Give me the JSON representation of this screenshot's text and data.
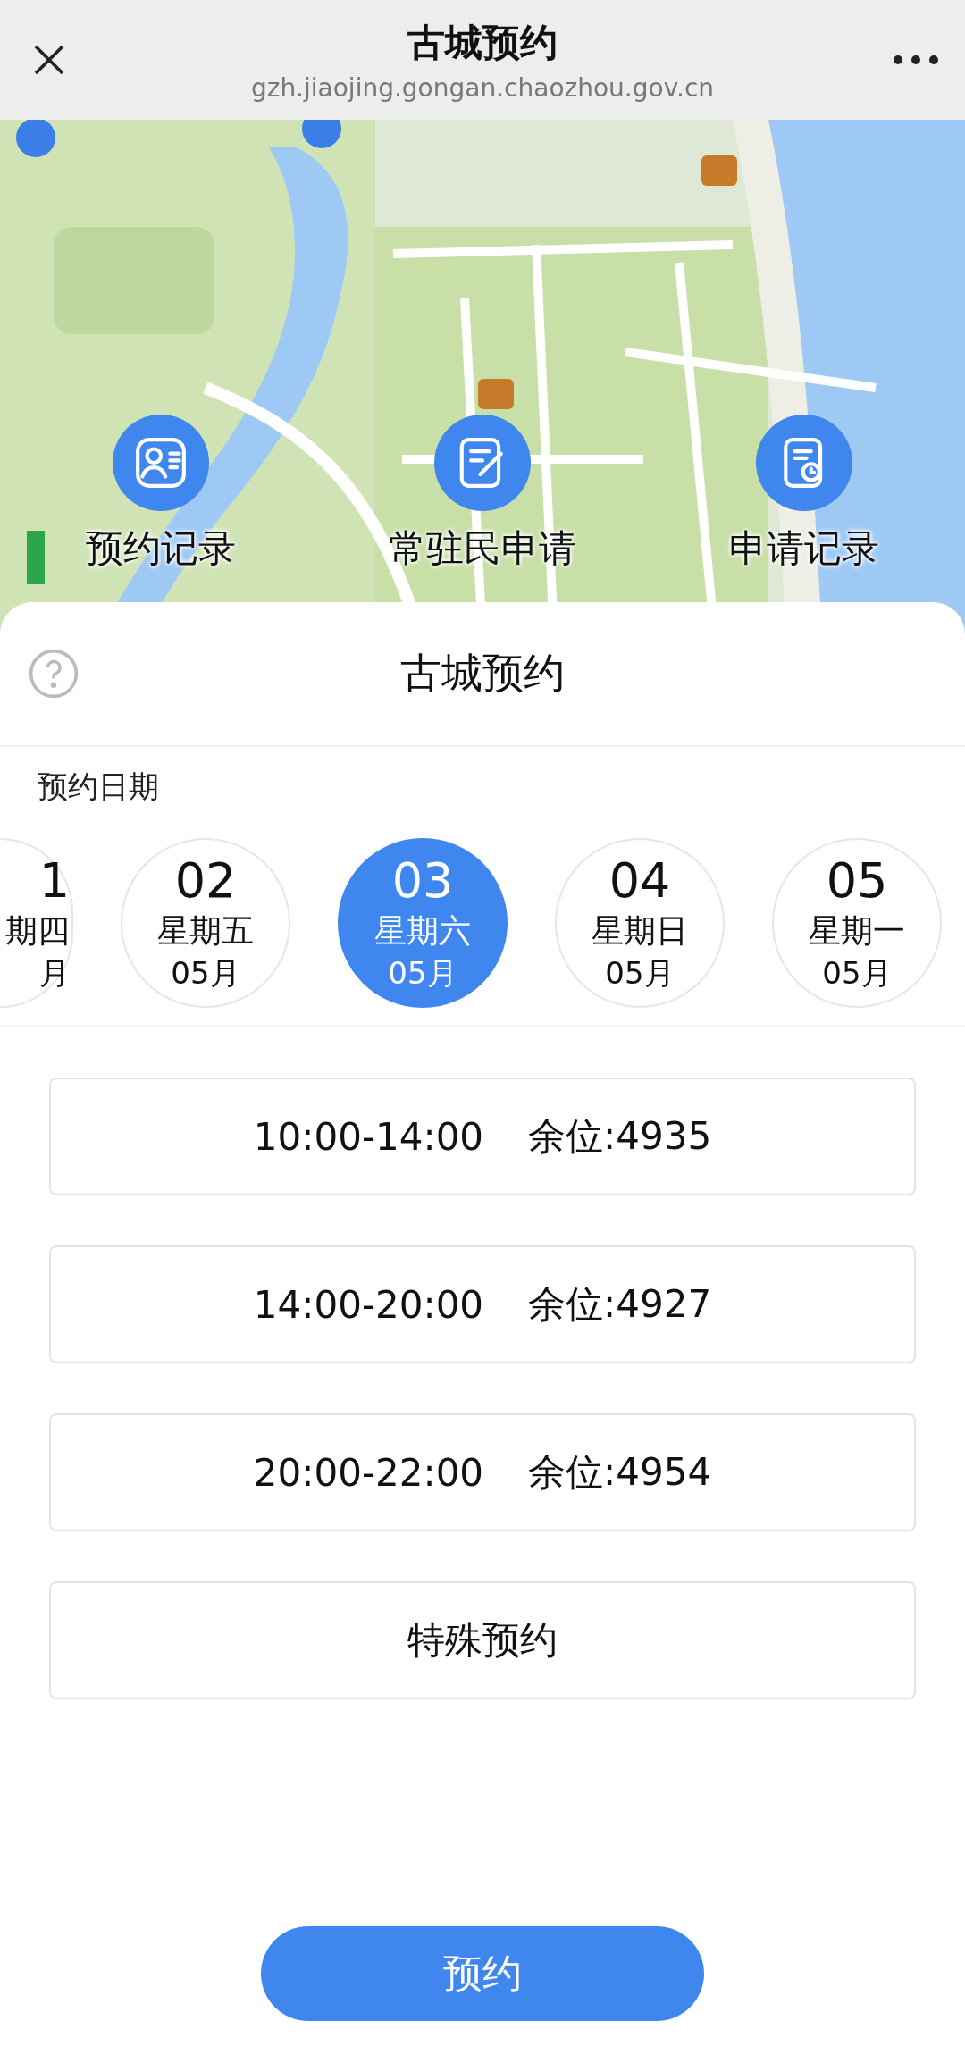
{
  "header": {
    "title": "古城预约",
    "url": "gzh.jiaojing.gongan.chaozhou.gov.cn"
  },
  "shortcuts": [
    {
      "label": "预约记录",
      "kind": "person"
    },
    {
      "label": "常驻民申请",
      "kind": "edit"
    },
    {
      "label": "申请记录",
      "kind": "clock"
    }
  ],
  "sheet": {
    "title": "古城预约",
    "section_label": "预约日期",
    "dates": [
      {
        "day": "1",
        "weekday": "期四",
        "month": "月",
        "selected": false,
        "kind": "partial"
      },
      {
        "day": "02",
        "weekday": "星期五",
        "month": "05月",
        "selected": false,
        "kind": "full"
      },
      {
        "day": "03",
        "weekday": "星期六",
        "month": "05月",
        "selected": true,
        "kind": "full"
      },
      {
        "day": "04",
        "weekday": "星期日",
        "month": "05月",
        "selected": false,
        "kind": "full"
      },
      {
        "day": "05",
        "weekday": "星期一",
        "month": "05月",
        "selected": false,
        "kind": "full"
      }
    ],
    "slots": [
      {
        "kind": "time",
        "time": "10:00-14:00",
        "remaining": "余位:4935"
      },
      {
        "kind": "time",
        "time": "14:00-20:00",
        "remaining": "余位:4927"
      },
      {
        "kind": "time",
        "time": "20:00-22:00",
        "remaining": "余位:4954"
      },
      {
        "kind": "special",
        "label": "特殊预约"
      }
    ],
    "submit": "预约"
  }
}
